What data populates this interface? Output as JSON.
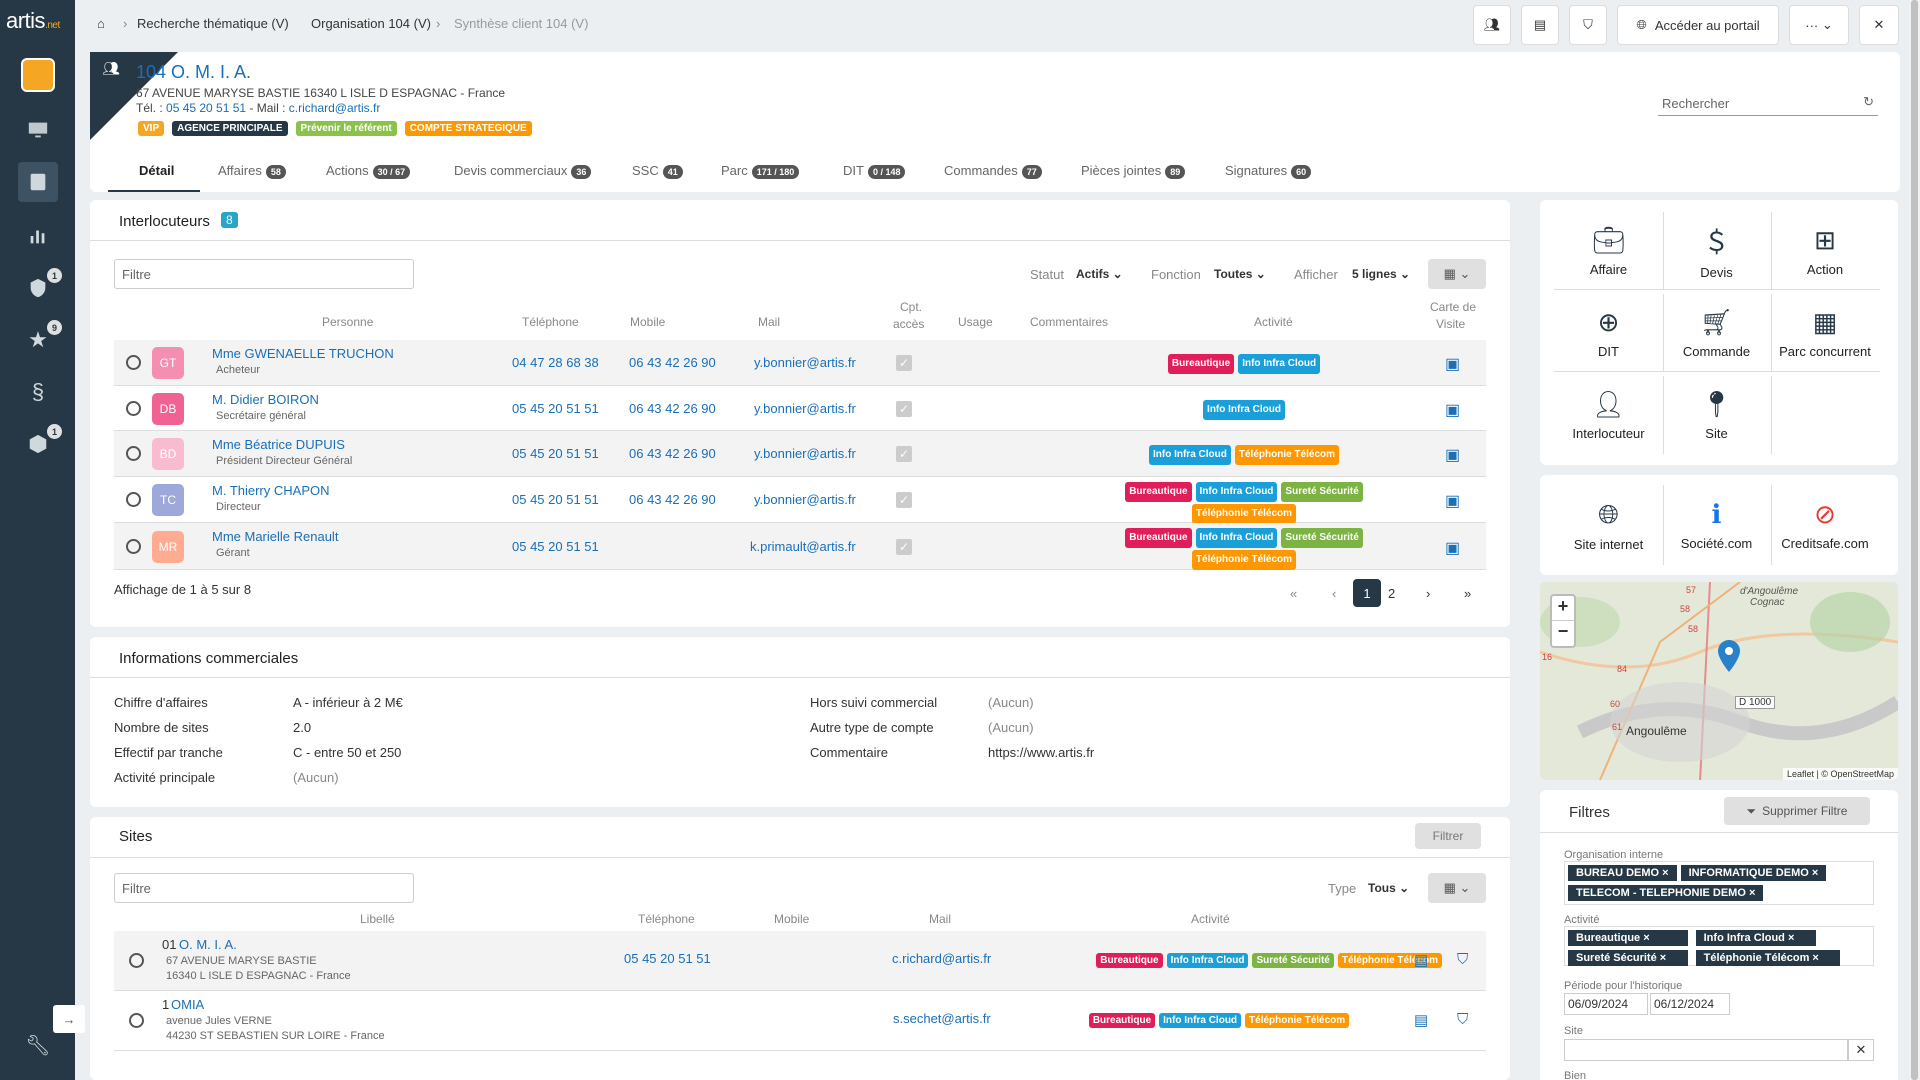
{
  "app": {
    "logo": "artis",
    "logo_suffix": ".net"
  },
  "rail": {
    "badges": [
      "1",
      "9",
      "1"
    ]
  },
  "breadcrumb": [
    "Recherche thématique (V)",
    "Organisation 104 (V)",
    "Synthèse client 104 (V)"
  ],
  "topbar": {
    "portal_label": "Accéder au portail",
    "more_label": "···"
  },
  "client": {
    "name": "104 O. M. I. A.",
    "address": "67 AVENUE MARYSE BASTIE 16340 L ISLE D ESPAGNAC - France",
    "tel_prefix": "Tél. :",
    "tel": "05 45 20 51 51",
    "mail_prefix": " - Mail :",
    "mail": "c.richard@artis.fr",
    "badges": [
      {
        "label": "VIP",
        "color": "#f5a623"
      },
      {
        "label": "AGENCE PRINCIPALE",
        "color": "#263846"
      },
      {
        "label": "Prévenir le référent",
        "color": "#8bc34a"
      },
      {
        "label": "COMPTE STRATEGIQUE",
        "color": "#ff9800"
      }
    ]
  },
  "search": {
    "placeholder": "Rechercher"
  },
  "tabs": [
    {
      "label": "Détail",
      "count": ""
    },
    {
      "label": "Affaires",
      "count": "58"
    },
    {
      "label": "Actions",
      "count": "30 / 67"
    },
    {
      "label": "Devis commerciaux",
      "count": "36"
    },
    {
      "label": "SSC",
      "count": "41"
    },
    {
      "label": "Parc",
      "count": "171 / 180"
    },
    {
      "label": "DIT",
      "count": "0 / 148"
    },
    {
      "label": "Commandes",
      "count": "77"
    },
    {
      "label": "Pièces jointes",
      "count": "89"
    },
    {
      "label": "Signatures",
      "count": "60"
    }
  ],
  "contacts": {
    "title": "Interlocuteurs",
    "count": "8",
    "filter_placeholder": "Filtre",
    "statut_label": "Statut",
    "statut_value": "Actifs",
    "fonction_label": "Fonction",
    "fonction_value": "Toutes",
    "afficher_label": "Afficher",
    "afficher_value": "5 lignes",
    "headers": {
      "personne": "Personne",
      "tel": "Téléphone",
      "mobile": "Mobile",
      "mail": "Mail",
      "cpt": "Cpt.",
      "acces": "accès",
      "usage": "Usage",
      "comments": "Commentaires",
      "activite": "Activité",
      "carte": "Carte de",
      "visite": "Visite"
    },
    "rows": [
      {
        "initials": "GT",
        "color": "#f48fb1",
        "name": "Mme GWENAELLE TRUCHON",
        "role": "Acheteur",
        "tel": "04 47 28 68 38",
        "mobile": "06 43 42 26 90",
        "mail": "y.bonnier@artis.fr"
      },
      {
        "initials": "DB",
        "color": "#f06292",
        "name": "M. Didier BOIRON",
        "role": "Secrétaire général",
        "tel": "05 45 20 51 51",
        "mobile": "06 43 42 26 90",
        "mail": "y.bonnier@artis.fr"
      },
      {
        "initials": "BD",
        "color": "#f8bbd0",
        "name": "Mme Béatrice DUPUIS",
        "role": "Président Directeur Général",
        "tel": "05 45 20 51 51",
        "mobile": "06 43 42 26 90",
        "mail": "y.bonnier@artis.fr"
      },
      {
        "initials": "TC",
        "color": "#9fa8da",
        "name": "M. Thierry CHAPON",
        "role": "Directeur",
        "tel": "05 45 20 51 51",
        "mobile": "06 43 42 26 90",
        "mail": "y.bonnier@artis.fr"
      },
      {
        "initials": "MR",
        "color": "#ffab91",
        "name": "Mme Marielle Renault",
        "role": "Gérant",
        "tel": "05 45 20 51 51",
        "mobile": "",
        "mail": "k.primault@artis.fr"
      }
    ],
    "tags": {
      "bur": "Bureautique",
      "info": "Info Infra Cloud",
      "sur": "Sureté Sécurité",
      "tel": "Téléphonie Télécom"
    },
    "summary": "Affichage de 1 à 5 sur 8",
    "pages": [
      "1",
      "2"
    ]
  },
  "commercial": {
    "title": "Informations commerciales",
    "left": [
      {
        "label": "Chiffre d'affaires",
        "value": "A - inférieur à 2 M€"
      },
      {
        "label": "Nombre de sites",
        "value": "2.0"
      },
      {
        "label": "Effectif par tranche",
        "value": "C - entre 50 et 250"
      },
      {
        "label": "Activité principale",
        "value": "(Aucun)"
      }
    ],
    "right": [
      {
        "label": "Hors suivi commercial",
        "value": "(Aucun)"
      },
      {
        "label": "Autre type de compte",
        "value": "(Aucun)"
      },
      {
        "label": "Commentaire",
        "value": "https://www.artis.fr"
      }
    ]
  },
  "sites": {
    "title": "Sites",
    "filter_button": "Filtrer",
    "filter_placeholder": "Filtre",
    "type_label": "Type",
    "type_value": "Tous",
    "headers": {
      "libelle": "Libellé",
      "tel": "Téléphone",
      "mobile": "Mobile",
      "mail": "Mail",
      "activite": "Activité"
    },
    "rows": [
      {
        "num": "01",
        "name": "O. M. I. A.",
        "addr1": "67 AVENUE MARYSE BASTIE",
        "addr2": "16340 L ISLE D ESPAGNAC - France",
        "tel": "05 45 20 51 51",
        "mail": "c.richard@artis.fr"
      },
      {
        "num": "1",
        "name": "OMIA",
        "addr1": "avenue Jules VERNE",
        "addr2": "44230 ST SEBASTIEN SUR LOIRE - France",
        "tel": "",
        "mail": "s.sechet@artis.fr"
      }
    ]
  },
  "quick_actions": [
    {
      "label": "Affaire",
      "icon": "briefcase-plus-icon"
    },
    {
      "label": "Devis",
      "icon": "money-plus-icon"
    },
    {
      "label": "Action",
      "icon": "action-plus-icon"
    },
    {
      "label": "DIT",
      "icon": "dit-plus-icon"
    },
    {
      "label": "Commande",
      "icon": "cart-plus-icon"
    },
    {
      "label": "Parc concurrent",
      "icon": "grid-plus-icon"
    },
    {
      "label": "Interlocuteur",
      "icon": "user-plus-icon"
    },
    {
      "label": "Site",
      "icon": "pin-plus-icon"
    }
  ],
  "links": [
    {
      "label": "Site internet",
      "icon": "globe-icon"
    },
    {
      "label": "Société.com",
      "icon": "info-icon"
    },
    {
      "label": "Creditsafe.com",
      "icon": "creditsafe-icon"
    }
  ],
  "map": {
    "city": "Angoulême",
    "north": "d'Angoulême",
    "north2": "Cognac",
    "road": "D 1000",
    "roads": [
      "57",
      "58",
      "58",
      "84",
      "60",
      "61",
      "16"
    ],
    "attribution": "Leaflet | © OpenStreetMap",
    "zoom_in": "+",
    "zoom_out": "−"
  },
  "filters": {
    "title": "Filtres",
    "clear_label": "Supprimer Filtre",
    "org_label": "Organisation interne",
    "org_chips": [
      "BUREAU DEMO",
      "INFORMATIQUE DEMO",
      "TELECOM - TELEPHONIE DEMO"
    ],
    "activity_label": "Activité",
    "period_label": "Période pour l'historique",
    "date_from": "06/09/2024",
    "date_to": "06/12/2024",
    "site_label": "Site",
    "bien_label": "Bien"
  },
  "colors": {
    "accent": "#1a6fb7",
    "rail": "#263846"
  }
}
